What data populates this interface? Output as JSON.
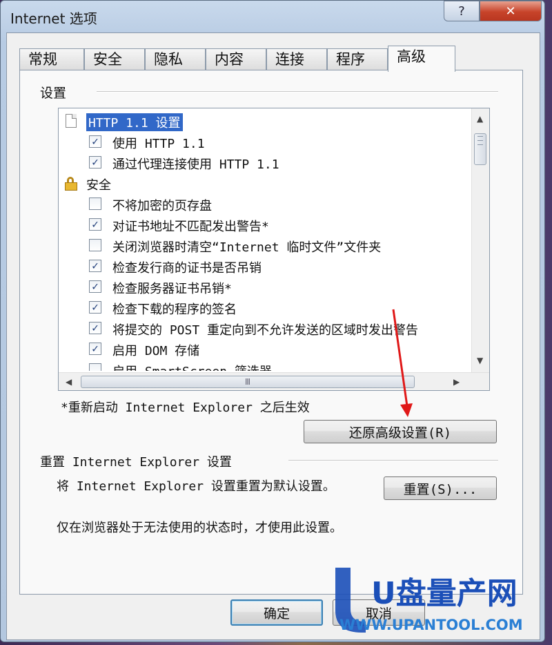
{
  "window": {
    "title": "Internet 选项",
    "help_label": "?",
    "close_label": "✕"
  },
  "tabs": [
    "常规",
    "安全",
    "隐私",
    "内容",
    "连接",
    "程序",
    "高级"
  ],
  "active_tab": "高级",
  "settings": {
    "group_label": "设置",
    "items": [
      {
        "type": "heading",
        "icon": "document-icon",
        "label": "HTTP 1.1 设置",
        "selected": true
      },
      {
        "type": "checkbox",
        "checked": true,
        "label": "使用 HTTP 1.1"
      },
      {
        "type": "checkbox",
        "checked": true,
        "label": "通过代理连接使用 HTTP 1.1"
      },
      {
        "type": "heading",
        "icon": "lock-icon",
        "label": "安全",
        "selected": false
      },
      {
        "type": "checkbox",
        "checked": false,
        "label": "不将加密的页存盘"
      },
      {
        "type": "checkbox",
        "checked": true,
        "label": "对证书地址不匹配发出警告*"
      },
      {
        "type": "checkbox",
        "checked": false,
        "label": "关闭浏览器时清空“Internet 临时文件”文件夹"
      },
      {
        "type": "checkbox",
        "checked": true,
        "label": "检查发行商的证书是否吊销"
      },
      {
        "type": "checkbox",
        "checked": true,
        "label": "检查服务器证书吊销*"
      },
      {
        "type": "checkbox",
        "checked": true,
        "label": "检查下载的程序的签名"
      },
      {
        "type": "checkbox",
        "checked": true,
        "label": "将提交的 POST 重定向到不允许发送的区域时发出警告"
      },
      {
        "type": "checkbox",
        "checked": true,
        "label": "启用 DOM 存储"
      },
      {
        "type": "checkbox",
        "checked": false,
        "label": "启用 SmartScreen 筛选器"
      }
    ],
    "scroll_grip": "Ⅲ",
    "restart_note": "*重新启动 Internet Explorer 之后生效",
    "restore_button": "还原高级设置(R)"
  },
  "reset": {
    "group_label": "重置 Internet Explorer 设置",
    "description": "将 Internet Explorer 设置重置为默认设置。",
    "button": "重置(S)...",
    "warning": "仅在浏览器处于无法使用的状态时，才使用此设置。"
  },
  "footer": {
    "ok": "确定",
    "cancel": "取消"
  },
  "watermark": {
    "brand": "U盘量产网",
    "url": "WWW.UPANTOOL.COM"
  },
  "colors": {
    "selection": "#3168c8",
    "annotation_arrow": "#e01818",
    "watermark_blue": "#1b4fb8"
  }
}
